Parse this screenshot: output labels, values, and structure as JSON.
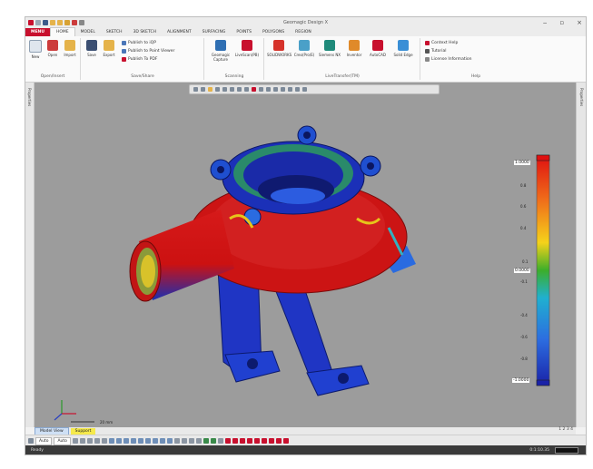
{
  "app": {
    "title": "Geomagic Design X"
  },
  "tabs": [
    "MENU",
    "HOME",
    "MODEL",
    "SKETCH",
    "3D SKETCH",
    "ALIGNMENT",
    "SURFACING",
    "POINTS",
    "POLYGONS",
    "REGION"
  ],
  "ribbon": {
    "open_import": {
      "label": "Open/Insert",
      "buttons": [
        "New",
        "Open",
        "Import"
      ]
    },
    "save_share": {
      "label": "Save/Share",
      "buttons": [
        "Save",
        "Export"
      ],
      "rows": [
        "Publish to iQP",
        "Publish to Point Viewer",
        "Publish To PDF"
      ]
    },
    "scanning": {
      "label": "Scanning",
      "buttons": [
        "Geomagic Capture",
        "LiveScan(PB)"
      ]
    },
    "livetransfer": {
      "label": "LiveTransfer(TM)",
      "buttons": [
        "SOLIDWORKS",
        "Creo(Pro/E)",
        "Siemens NX",
        "Inventor",
        "AutoCAD",
        "Solid Edge"
      ]
    },
    "help": {
      "label": "Help",
      "rows": [
        "Context Help",
        "Tutorial",
        "License Information"
      ]
    }
  },
  "side": {
    "left_label": "Properties",
    "right_label": "Properties"
  },
  "colorbar": {
    "top": "1.0000",
    "bottom": "-1.0000",
    "mid": "0.0000",
    "ticks": [
      "0.8",
      "0.6",
      "0.4",
      "0.1",
      "-0.1",
      "-0.4",
      "-0.6",
      "-0.8"
    ]
  },
  "scale": {
    "label": "20 mm"
  },
  "bottom": {
    "tab1": "Model View",
    "tab2": "Support",
    "dd1": "Auto",
    "dd2": "Auto",
    "pager": "1 2 3 4"
  },
  "status": {
    "text": "Ready",
    "right": "0:1:10.35"
  },
  "colors": {
    "accent": "#c8102e",
    "viewport": "#9c9c9c"
  }
}
